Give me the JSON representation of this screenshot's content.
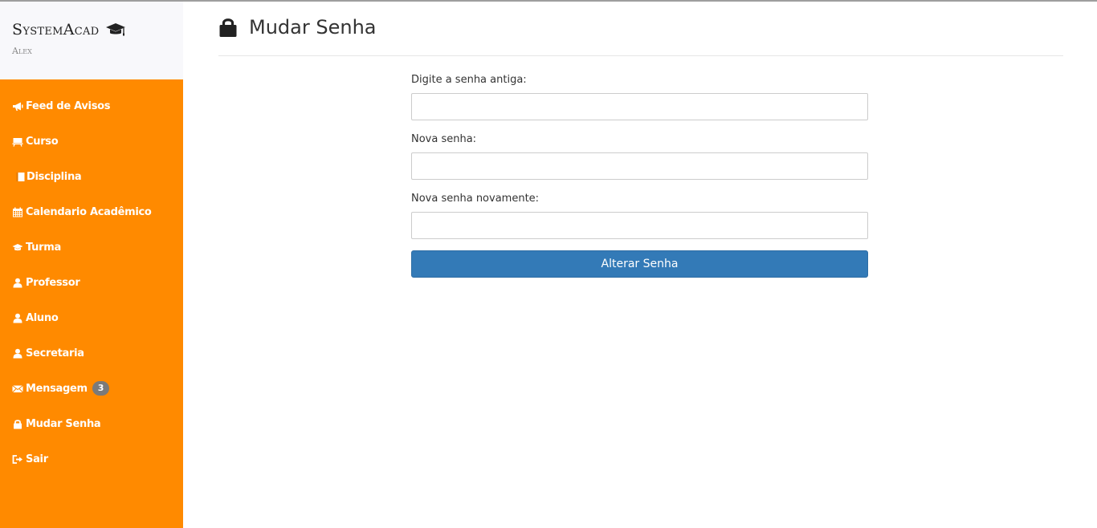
{
  "brand": {
    "title": "SystemAcad",
    "user": "Alex"
  },
  "sidebar": {
    "items": [
      {
        "label": "Feed de Avisos",
        "icon": "bullhorn-icon"
      },
      {
        "label": "Curso",
        "icon": "presentation-icon"
      },
      {
        "label": "Disciplina",
        "icon": "book-icon"
      },
      {
        "label": "Calendario Acadêmico",
        "icon": "calendar-icon"
      },
      {
        "label": "Turma",
        "icon": "graduation-cap-icon"
      },
      {
        "label": "Professor",
        "icon": "user-icon"
      },
      {
        "label": "Aluno",
        "icon": "user-icon"
      },
      {
        "label": "Secretaria",
        "icon": "user-icon"
      },
      {
        "label": "Mensagem",
        "icon": "envelope-icon",
        "badge": "3"
      },
      {
        "label": "Mudar Senha",
        "icon": "lock-icon"
      },
      {
        "label": "Sair",
        "icon": "log-out-icon"
      }
    ]
  },
  "header": {
    "title": "Mudar Senha",
    "icon": "lock-icon"
  },
  "form": {
    "old_password_label": "Digite a senha antiga:",
    "new_password_label": "Nova senha:",
    "confirm_password_label": "Nova senha novamente:",
    "submit_label": "Alterar Senha"
  },
  "colors": {
    "sidebar": "#ff8a00",
    "primary_button": "#337ab7"
  }
}
